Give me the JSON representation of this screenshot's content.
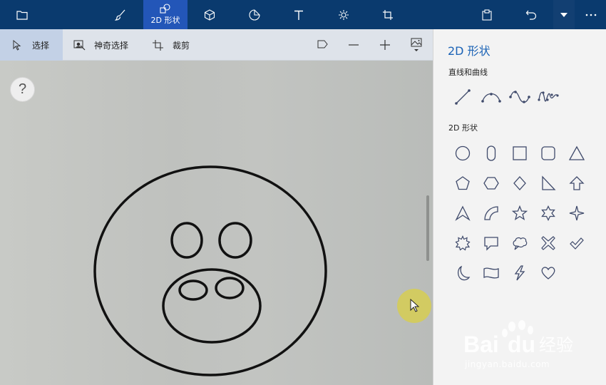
{
  "toolbar": {
    "active_tab_label": "2D 形状",
    "items": [
      "menu",
      "brushes",
      "2d-shapes",
      "3d-shapes",
      "stickers",
      "text",
      "effects",
      "canvas",
      "paste",
      "undo",
      "history",
      "more"
    ]
  },
  "subbar": {
    "select_label": "选择",
    "magic_select_label": "神奇选择",
    "crop_label": "裁剪"
  },
  "canvas": {
    "help_label": "?"
  },
  "panel": {
    "title": "2D 形状",
    "lines_section": "直线和曲线",
    "shapes_section": "2D 形状"
  },
  "watermark": {
    "brand": "Baidu 经验",
    "url": "jingyan.baidu.com"
  },
  "colors": {
    "topbar": "#0a3a6e",
    "active_tab": "#2356b8",
    "subbar": "#dee3ea",
    "panel": "#f3f3f3",
    "accent": "#1b63b6",
    "shape_stroke": "#3f4a6b"
  }
}
